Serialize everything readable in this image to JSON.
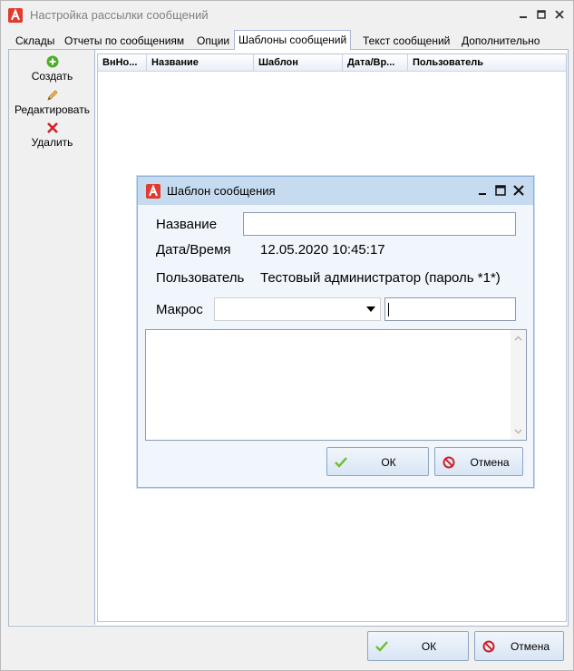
{
  "window": {
    "title": "Настройка рассылки сообщений",
    "icon": "app-logo-icon",
    "controls": [
      "minimize-icon",
      "maximize-icon",
      "close-icon"
    ]
  },
  "tabs": [
    {
      "label": "Склады",
      "active": false
    },
    {
      "label": "Отчеты по сообщениям",
      "active": false
    },
    {
      "label": "Опции",
      "active": false
    },
    {
      "label": "Шаблоны сообщений",
      "active": true
    },
    {
      "label": "Текст сообщений",
      "active": false
    },
    {
      "label": "Дополнительно",
      "active": false
    }
  ],
  "toolbar": {
    "create": {
      "label": "Создать",
      "icon": "add-icon"
    },
    "edit": {
      "label": "Редактировать",
      "icon": "pencil-icon"
    },
    "delete": {
      "label": "Удалить",
      "icon": "delete-x-icon"
    }
  },
  "grid": {
    "columns": [
      "ВнНо...",
      "Название",
      "Шаблон",
      "Дата/Вр...",
      "Пользователь"
    ],
    "rows": []
  },
  "footer": {
    "ok_label": "ОК",
    "cancel_label": "Отмена"
  },
  "dialog": {
    "title": "Шаблон сообщения",
    "name_label": "Название",
    "name_value": "",
    "datetime_label": "Дата/Время",
    "datetime_value": "12.05.2020 10:45:17",
    "user_label": "Пользователь",
    "user_value": "Тестовый администратор (пароль *1*)",
    "macro_label": "Макрос",
    "macro_selected": "",
    "macro_text": "",
    "body_text": "",
    "ok_label": "ОК",
    "cancel_label": "Отмена"
  },
  "colors": {
    "accent": "#c6daf0",
    "brand": "#e23a2e",
    "ok_check": "#6cbf2a",
    "cancel_red": "#d0202a"
  }
}
